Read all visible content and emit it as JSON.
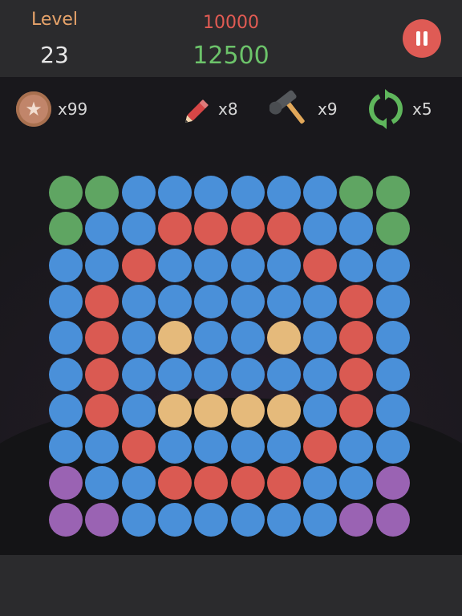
{
  "header": {
    "level_label": "Level",
    "level_value": "23",
    "target_score": "10000",
    "current_score": "12500",
    "pause_icon": "pause-icon"
  },
  "tools": [
    {
      "name": "coin",
      "icon": "star-coin-icon",
      "count": "x99"
    },
    {
      "name": "pencil",
      "icon": "pencil-icon",
      "count": "x8"
    },
    {
      "name": "hammer",
      "icon": "hammer-icon",
      "count": "x9"
    },
    {
      "name": "shuffle",
      "icon": "refresh-icon",
      "count": "x5"
    }
  ],
  "colors": {
    "G": "#5fa562",
    "B": "#4a90d9",
    "R": "#da5a52",
    "Y": "#e5ba7b",
    "P": "#9a63b3",
    "accent_pause": "#df5b55"
  },
  "board": {
    "rows": [
      "GGBBBBBBGG",
      "GBBRRRRBBG",
      "BBRBBBBRBB",
      "BRBBBBBBRB",
      "BRBYBBYBRB",
      "BRBBBBBBRB",
      "BRBYYYYBRB",
      "BBRBBBBRBB",
      "PBBRRRRBBP",
      "PPBBBBBBPP"
    ]
  }
}
